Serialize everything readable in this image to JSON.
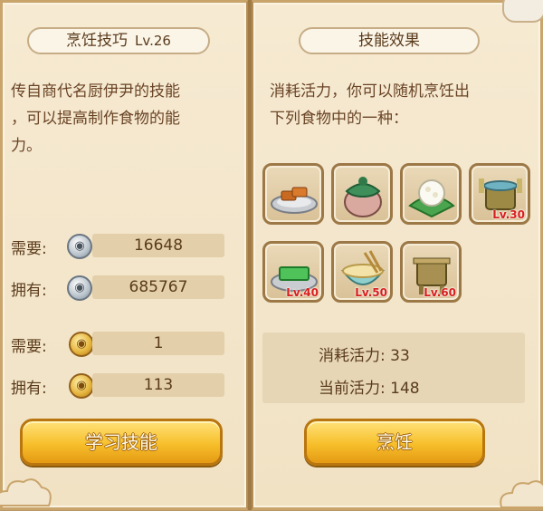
{
  "left_panel": {
    "title": "烹饪技巧",
    "level": "Lv.26",
    "description_lines": [
      "传自商代名厨伊尹的技能",
      "，可以提高制作食物的能",
      "力。"
    ],
    "rows": [
      {
        "label": "需要:",
        "currency": "silver",
        "value": "16648"
      },
      {
        "label": "拥有:",
        "currency": "silver",
        "value": "685767"
      },
      {
        "label": "需要:",
        "currency": "gold",
        "value": "1"
      },
      {
        "label": "拥有:",
        "currency": "gold",
        "value": "113"
      }
    ],
    "learn_button": "学习技能"
  },
  "right_panel": {
    "title": "技能效果",
    "description_lines": [
      "消耗活力，你可以随机烹饪出",
      "下列食物中的一种："
    ],
    "foods": [
      {
        "icon": "tofu-plate-icon",
        "level": ""
      },
      {
        "icon": "pickle-jar-icon",
        "level": ""
      },
      {
        "icon": "rice-dumpling-icon",
        "level": ""
      },
      {
        "icon": "bronze-pot-icon",
        "level": "Lv.30"
      },
      {
        "icon": "green-cake-icon",
        "level": "Lv.40"
      },
      {
        "icon": "noodle-bowl-icon",
        "level": "Lv.50"
      },
      {
        "icon": "bronze-tripod-icon",
        "level": "Lv.60"
      }
    ],
    "stats": {
      "consume": "消耗活力: 33",
      "current": "当前活力: 148"
    },
    "cook_button": "烹饪"
  },
  "colors": {
    "panel_bg": "#f4e6ca",
    "button_gold": "#f7bf2b",
    "level_red": "#d81e1e",
    "text_brown": "#5a3b1c"
  }
}
